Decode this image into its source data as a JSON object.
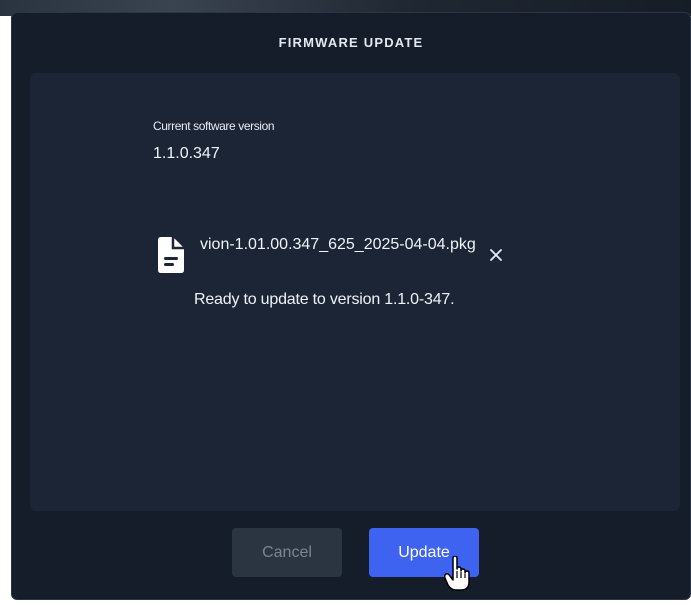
{
  "dialog": {
    "title": "FIRMWARE UPDATE"
  },
  "current_version": {
    "label": "Current software version",
    "value": "1.1.0.347"
  },
  "file": {
    "icon": "file-icon",
    "name": "vion-1.01.00.347_625_2025-04-04.pkg",
    "remove_icon": "close-icon"
  },
  "status": {
    "message": "Ready to update to version 1.1.0-347."
  },
  "buttons": {
    "cancel_label": "Cancel",
    "update_label": "Update"
  },
  "colors": {
    "dialog_bg": "#151d2a",
    "panel_bg": "#1c2535",
    "primary": "#3d63f0",
    "secondary_btn": "#2b3441"
  }
}
